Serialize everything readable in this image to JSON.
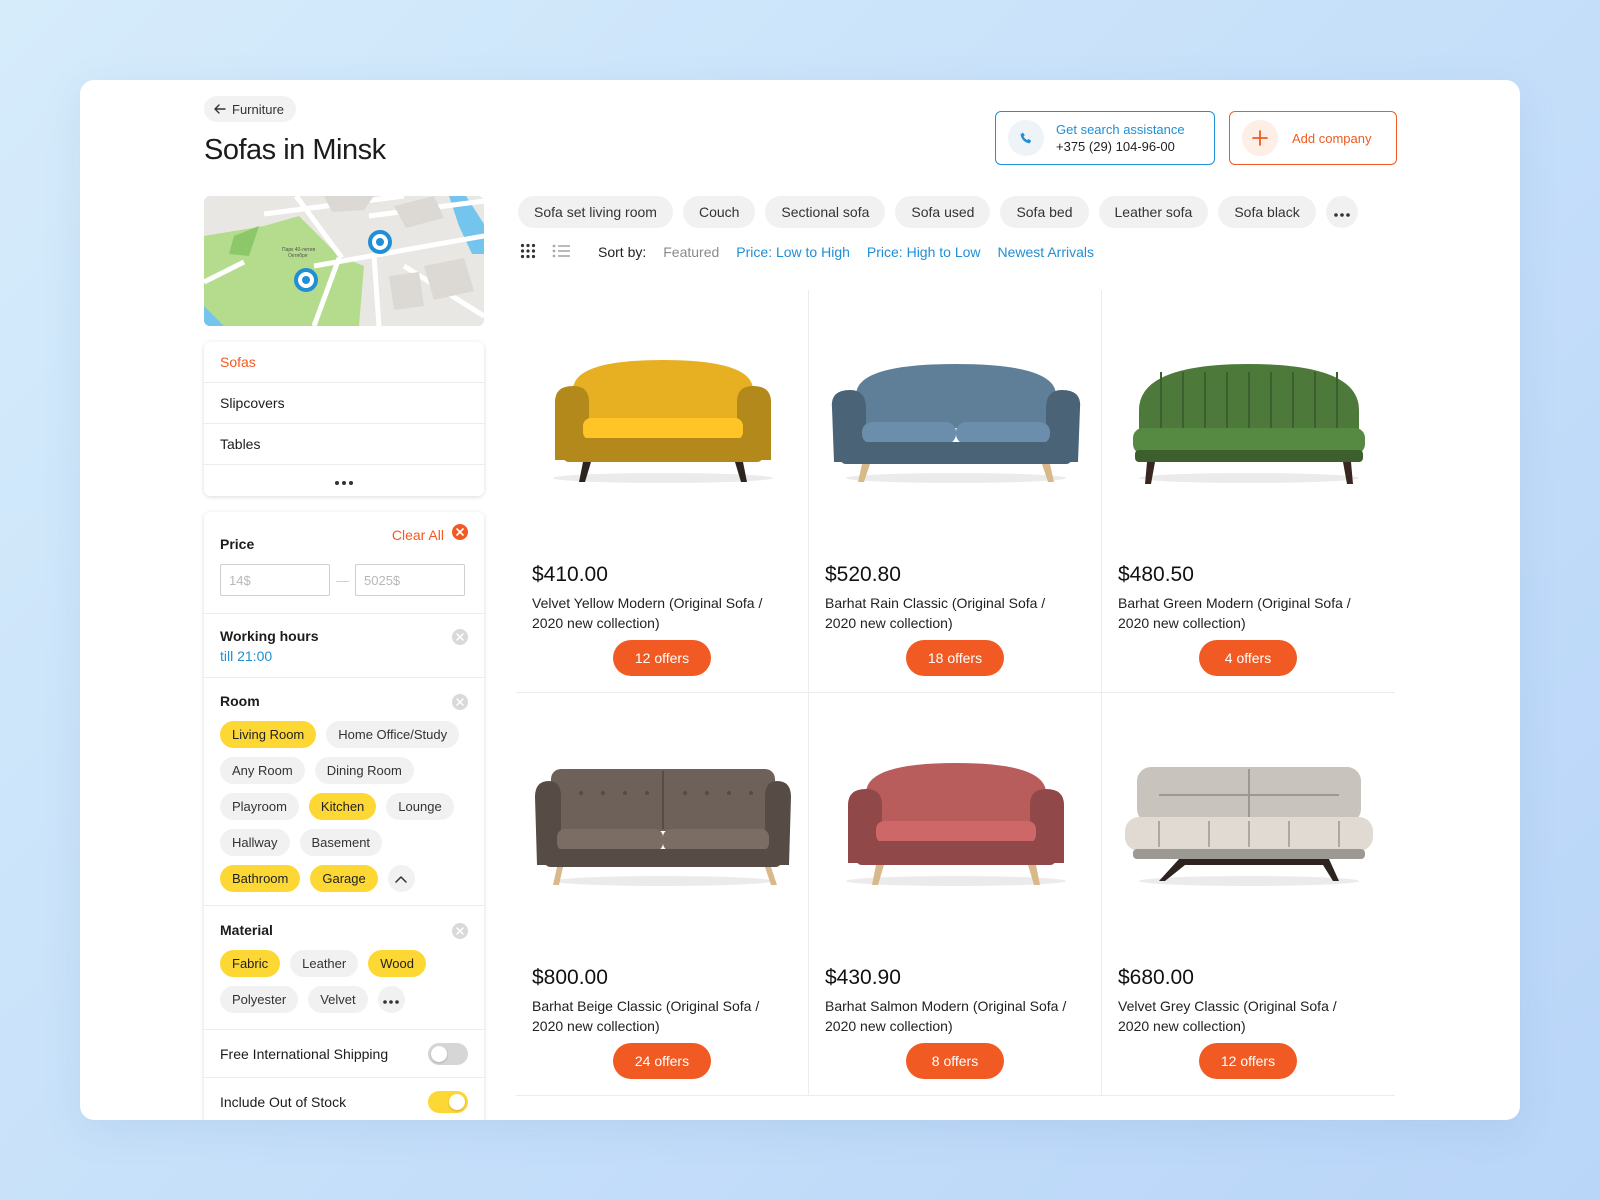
{
  "breadcrumb": {
    "label": "Furniture"
  },
  "page": {
    "title": "Sofas in Minsk"
  },
  "assist": {
    "label": "Get search assistance",
    "phone": "+375 (29) 104-96-00"
  },
  "add_company": {
    "label": "Add company"
  },
  "categories": {
    "items": [
      "Sofas",
      "Slipcovers",
      "Tables"
    ],
    "active": "Sofas"
  },
  "filters": {
    "clear_all": "Clear All",
    "price": {
      "title": "Price",
      "min_placeholder": "14$",
      "max_placeholder": "5025$",
      "separator": "—"
    },
    "hours": {
      "title": "Working hours",
      "value": "till 21:00"
    },
    "room": {
      "title": "Room",
      "options": [
        {
          "label": "Living Room",
          "selected": true
        },
        {
          "label": "Home Office/Study",
          "selected": false
        },
        {
          "label": "Any Room",
          "selected": false
        },
        {
          "label": "Dining Room",
          "selected": false
        },
        {
          "label": "Playroom",
          "selected": false
        },
        {
          "label": "Kitchen",
          "selected": true
        },
        {
          "label": "Lounge",
          "selected": false
        },
        {
          "label": "Hallway",
          "selected": false
        },
        {
          "label": "Basement",
          "selected": false
        },
        {
          "label": "Bathroom",
          "selected": true
        },
        {
          "label": "Garage",
          "selected": true
        }
      ]
    },
    "material": {
      "title": "Material",
      "options": [
        {
          "label": "Fabric",
          "selected": true
        },
        {
          "label": "Leather",
          "selected": false
        },
        {
          "label": "Wood",
          "selected": true
        },
        {
          "label": "Polyester",
          "selected": false
        },
        {
          "label": "Velvet",
          "selected": false
        }
      ]
    },
    "shipping": {
      "label": "Free International Shipping",
      "on": false
    },
    "stock": {
      "label": "Include Out of Stock",
      "on": true
    }
  },
  "tags": [
    "Sofa set living room",
    "Couch",
    "Sectional sofa",
    "Sofa used",
    "Sofa bed",
    "Leather sofa",
    "Sofa black"
  ],
  "sort": {
    "label": "Sort by:",
    "options": [
      "Featured",
      "Price: Low to High",
      "Price: High to Low",
      "Newest Arrivals"
    ],
    "active": "Featured"
  },
  "products": [
    {
      "price": "$410.00",
      "name": "Velvet Yellow Modern (Original Sofa / 2020 new collection)",
      "offers": "12 offers",
      "color": "#e6b022",
      "legs": "#2d2420",
      "style": "round"
    },
    {
      "price": "$520.80",
      "name": "Barhat Rain Classic (Original Sofa / 2020 new collection)",
      "offers": "18 offers",
      "color": "#5f7f99",
      "legs": "#d8b98a",
      "style": "wide"
    },
    {
      "price": "$480.50",
      "name": "Barhat Green Modern (Original Sofa / 2020 new collection)",
      "offers": "4 offers",
      "color": "#4d7a3a",
      "legs": "#3a2620",
      "style": "shell"
    },
    {
      "price": "$800.00",
      "name": " Barhat Beige Classic (Original Sofa / 2020 new collection)",
      "offers": "24 offers",
      "color": "#6e6159",
      "legs": "#d8b98a",
      "style": "long"
    },
    {
      "price": "$430.90",
      "name": "Barhat Salmon Modern (Original Sofa / 2020 new collection)",
      "offers": "8 offers",
      "color": "#b85c5c",
      "legs": "#d8b98a",
      "style": "round"
    },
    {
      "price": "$680.00",
      "name": "Velvet Grey Classic (Original Sofa / 2020 new collection)",
      "offers": "12 offers",
      "color": "#c8c3bc",
      "legs": "#2d2420",
      "style": "bed"
    }
  ],
  "colors": {
    "accent": "#f15a22",
    "link": "#1f8fd6",
    "chip_selected": "#fdd835"
  }
}
